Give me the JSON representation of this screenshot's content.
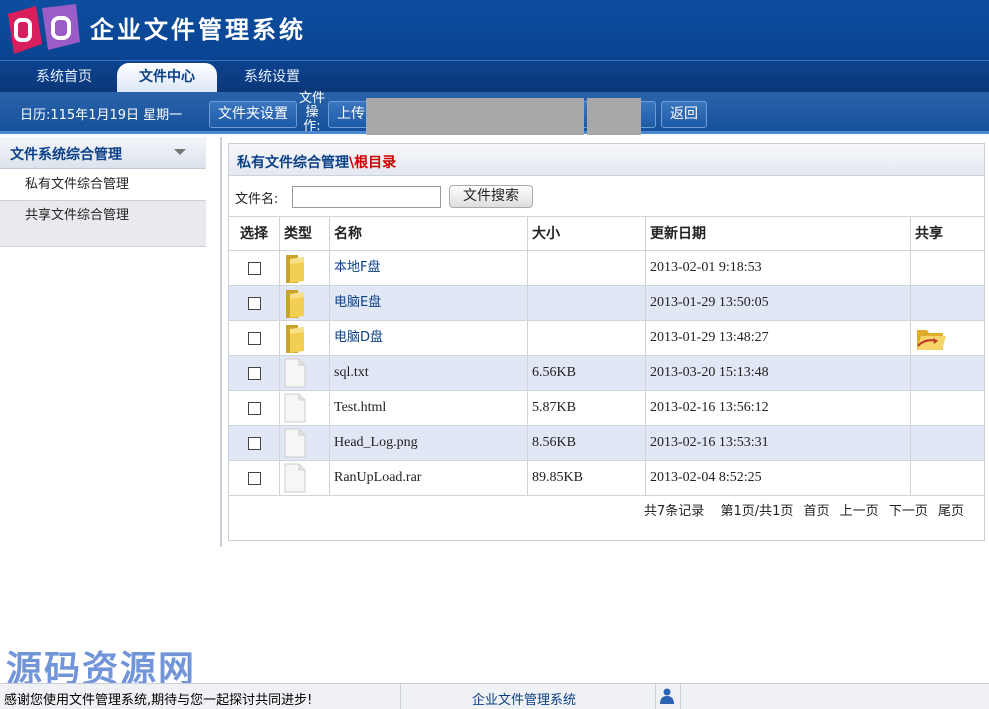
{
  "app": {
    "title": "企业文件管理系统"
  },
  "nav": {
    "tabs": [
      {
        "label": "系统首页",
        "active": false
      },
      {
        "label": "文件中心",
        "active": true
      },
      {
        "label": "系统设置",
        "active": false
      }
    ]
  },
  "toolbar": {
    "calendar": "日历:115年1月19日 星期一",
    "folder_settings": "文件夹设置",
    "file_op_label": "文件操作:",
    "upload": "上传",
    "back": "返回"
  },
  "sidebar": {
    "title": "文件系统综合管理",
    "items": [
      {
        "label": "私有文件综合管理"
      },
      {
        "label": "共享文件综合管理"
      }
    ]
  },
  "main": {
    "breadcrumb": {
      "section": "私有文件综合管理",
      "separator": "\\",
      "root": "根目录"
    },
    "search": {
      "label": "文件名:",
      "value": "",
      "button": "文件搜索"
    },
    "columns": [
      "选择",
      "类型",
      "名称",
      "大小",
      "更新日期",
      "共享"
    ],
    "rows": [
      {
        "type": "folder",
        "name": "本地F盘",
        "size": "",
        "date": "2013-02-01 9:18:53",
        "shared": false
      },
      {
        "type": "folder",
        "name": "电脑E盘",
        "size": "",
        "date": "2013-01-29 13:50:05",
        "shared": false
      },
      {
        "type": "folder",
        "name": "电脑D盘",
        "size": "",
        "date": "2013-01-29 13:48:27",
        "shared": true
      },
      {
        "type": "file",
        "name": "sql.txt",
        "size": "6.56KB",
        "date": "2013-03-20 15:13:48",
        "shared": false
      },
      {
        "type": "file",
        "name": "Test.html",
        "size": "5.87KB",
        "date": "2013-02-16 13:56:12",
        "shared": false
      },
      {
        "type": "file",
        "name": "Head_Log.png",
        "size": "8.56KB",
        "date": "2013-02-16 13:53:31",
        "shared": false
      },
      {
        "type": "file",
        "name": "RanUpLoad.rar",
        "size": "89.85KB",
        "date": "2013-02-04 8:52:25",
        "shared": false
      }
    ],
    "pager": {
      "total": "共7条记录",
      "page": "第1页/共1页",
      "first": "首页",
      "prev": "上一页",
      "next": "下一页",
      "last": "尾页"
    }
  },
  "watermark": "源码资源网",
  "status": {
    "message": "感谢您使用文件管理系统,期待与您一起探讨共同进步!",
    "app_name": "企业文件管理系统"
  },
  "icons": {
    "logo": "logo-icon",
    "folder": "folder-icon",
    "file": "document-icon",
    "shared": "shared-folder-icon",
    "user": "user-icon",
    "chevron": "chevron-down-icon"
  },
  "colors": {
    "brand": "#0d4ea0",
    "row_alt": "#e2e7f6",
    "breadcrumb_root": "#cc0000"
  }
}
